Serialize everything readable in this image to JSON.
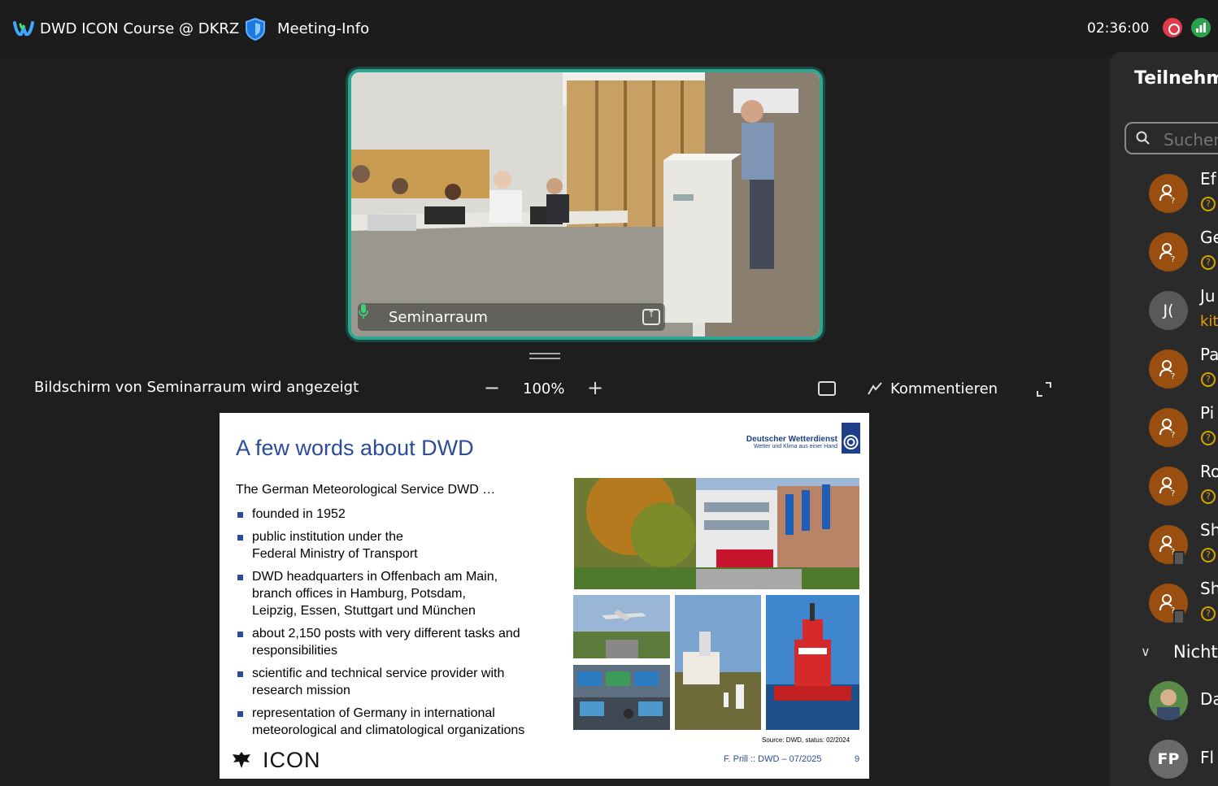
{
  "header": {
    "meeting_title": "DWD ICON Course @ DKRZ",
    "meeting_info": "Meeting-Info",
    "timer": "02:36:00"
  },
  "video": {
    "name": "Seminarraum"
  },
  "share_bar": {
    "status": "Bildschirm von Seminarraum wird angezeigt",
    "zoom_out": "−",
    "zoom_level": "100%",
    "zoom_in": "+",
    "annotate_label": "Kommentieren"
  },
  "slide": {
    "title": "A few words about DWD",
    "logo_name": "Deutscher Wetterdienst",
    "logo_sub": "Wetter und Klima aus einer Hand",
    "intro": "The German Meteorological Service DWD …",
    "bullets": [
      "founded in 1952",
      "public institution under the\nFederal Ministry of Transport",
      "DWD headquarters in Offenbach am Main,\nbranch offices in Hamburg, Potsdam,\nLeipzig, Essen, Stuttgart und München",
      "about 2,150 posts with very different tasks and\nresponsibilities",
      "scientific and technical service provider with\nresearch mission",
      "representation of Germany in international\nmeteorological and climatological organizations"
    ],
    "source": "Source: DWD, status: 02/2024",
    "icon_logo": "ICON",
    "footer": "F. Prill :: DWD – 07/2025",
    "page": "9"
  },
  "panel": {
    "title": "Teilnehm",
    "search_placeholder": "Suchen",
    "participants": [
      {
        "name": "Ef",
        "type": "guest"
      },
      {
        "name": "Ge",
        "type": "guest"
      },
      {
        "name": "Ju",
        "initials": "J(",
        "sub": "kit"
      },
      {
        "name": "Pa",
        "type": "guest"
      },
      {
        "name": "Pi",
        "type": "guest"
      },
      {
        "name": "Ro",
        "type": "guest"
      },
      {
        "name": "Sh",
        "type": "guest-mobile"
      },
      {
        "name": "Sh",
        "type": "guest-mobile"
      }
    ],
    "section_label": "Nicht",
    "section_participants": [
      {
        "name": "Da",
        "type": "photo"
      },
      {
        "name": "Fl",
        "initials": "FP"
      }
    ]
  },
  "colors": {
    "accent_frame": "#2ea694",
    "guest_avatar": "#9a4f10",
    "slide_blue": "#2c4b9b"
  }
}
